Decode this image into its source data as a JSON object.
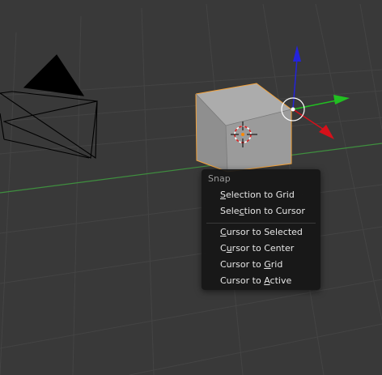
{
  "colors": {
    "viewport_bg": "#393939",
    "grid_line": "#444444",
    "x_axis": "#8a3838",
    "y_axis": "#479447",
    "cube_top": "#acacac",
    "cube_front": "#9c9c9c",
    "cube_right": "#8e8e8e",
    "selection_outline": "#f3a23a",
    "manipulator_x": "#d6101a",
    "manipulator_y": "#21c021",
    "manipulator_z": "#2323dc",
    "menu_bg": "#161616",
    "menu_text": "#e6e6e6",
    "menu_title": "#9a9a9a"
  },
  "icons": {
    "camera": "camera-object-icon",
    "cursor": "3d-cursor-icon",
    "manipulator": "transform-manipulator-icon"
  },
  "snap_menu": {
    "title": "Snap",
    "items": [
      {
        "label": "Selection to Grid",
        "mnemonic_prefix": "",
        "mnemonic": "S",
        "mnemonic_suffix": "election to Grid"
      },
      {
        "label": "Selection to Cursor",
        "mnemonic_prefix": "Sele",
        "mnemonic": "c",
        "mnemonic_suffix": "tion to Cursor"
      },
      {
        "label": "Cursor to Selected",
        "mnemonic_prefix": "",
        "mnemonic": "C",
        "mnemonic_suffix": "ursor to Selected"
      },
      {
        "label": "Cursor to Center",
        "mnemonic_prefix": "C",
        "mnemonic": "u",
        "mnemonic_suffix": "rsor to Center"
      },
      {
        "label": "Cursor to Grid",
        "mnemonic_prefix": "Cursor to ",
        "mnemonic": "G",
        "mnemonic_suffix": "rid"
      },
      {
        "label": "Cursor to Active",
        "mnemonic_prefix": "Cursor to ",
        "mnemonic": "A",
        "mnemonic_suffix": "ctive"
      }
    ]
  }
}
